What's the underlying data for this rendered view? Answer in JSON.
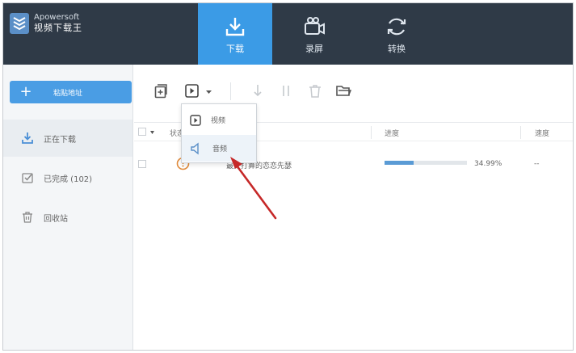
{
  "app": {
    "brand_name": "Apowersoft",
    "brand_title": "视频下载王"
  },
  "nav": {
    "tabs": [
      {
        "label": "下载",
        "icon": "download-icon",
        "active": true
      },
      {
        "label": "录屏",
        "icon": "record-screen-icon",
        "active": false
      },
      {
        "label": "转换",
        "icon": "convert-icon",
        "active": false
      }
    ]
  },
  "sidebar": {
    "paste_button_label": "粘贴地址",
    "items": [
      {
        "label": "正在下载",
        "icon": "download-icon",
        "active": true
      },
      {
        "label": "已完成 (102)",
        "icon": "completed-icon",
        "active": false
      },
      {
        "label": "回收站",
        "icon": "trash-icon",
        "active": false
      }
    ]
  },
  "toolbar": {
    "icons": [
      "add-task-icon",
      "media-type-icon",
      "chevron-down-icon",
      "download-arrow-icon",
      "pause-icon",
      "delete-icon",
      "open-folder-icon"
    ]
  },
  "dropdown": {
    "items": [
      {
        "label": "视频",
        "icon": "video-icon"
      },
      {
        "label": "音频",
        "icon": "audio-icon"
      }
    ]
  },
  "table": {
    "headers": {
      "status": "状态",
      "progress": "进度",
      "speed": "速度"
    },
    "rows": [
      {
        "name": "最好打算的恋恋先瑟",
        "progress_text": "34.99%",
        "progress_value": 0.3499,
        "speed": "--"
      }
    ]
  },
  "colors": {
    "topbar": "#2f3a47",
    "accent": "#3b9be6",
    "arrow": "#c62828"
  }
}
